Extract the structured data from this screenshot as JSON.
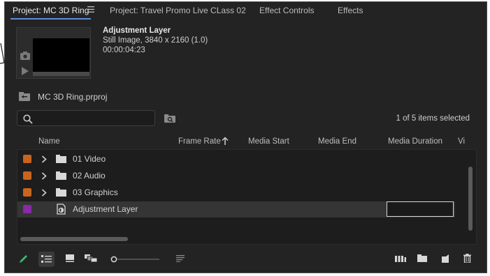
{
  "tabs": [
    {
      "label": "Project: MC 3D Ring",
      "active": true
    },
    {
      "label": "Project: Travel Promo Live CLass 02",
      "active": false
    },
    {
      "label": "Effect Controls",
      "active": false
    },
    {
      "label": "Effects",
      "active": false
    }
  ],
  "preview": {
    "name": "Adjustment Layer",
    "detail": "Still Image, 3840 x 2160 (1.0)",
    "duration": "00:00:04:23"
  },
  "project": {
    "file": "MC 3D Ring.prproj"
  },
  "search": {
    "value": "",
    "placeholder": ""
  },
  "selection_status": "1 of 5 items selected",
  "columns": [
    "Name",
    "Frame Rate",
    "Media Start",
    "Media End",
    "Media Duration",
    "Vi"
  ],
  "rows": [
    {
      "label": "01 Video",
      "color": "#c8641e",
      "type": "folder"
    },
    {
      "label": "02 Audio",
      "color": "#c8641e",
      "type": "folder"
    },
    {
      "label": "03 Graphics",
      "color": "#c8641e",
      "type": "folder"
    },
    {
      "label": "Adjustment Layer",
      "color": "#8a2aa8",
      "type": "adjustment-layer"
    }
  ],
  "accent": "#5d8cd6",
  "toolbar": {
    "icons": [
      "pencil-icon",
      "list-view-icon",
      "icon-view-icon",
      "freeform-view-icon",
      "zoom-slider",
      "sort-icon",
      "automate-to-sequence-icon",
      "new-bin-icon",
      "new-item-icon",
      "trash-icon"
    ]
  }
}
